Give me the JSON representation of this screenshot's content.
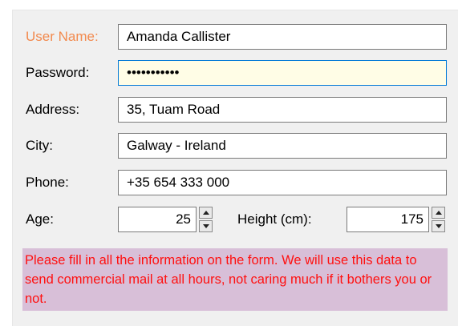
{
  "form": {
    "username": {
      "label": "User Name:",
      "value": "Amanda Callister"
    },
    "password": {
      "label": "Password:",
      "value": "•••••••••••"
    },
    "address": {
      "label": "Address:",
      "value": "35, Tuam Road"
    },
    "city": {
      "label": "City:",
      "value": "Galway - Ireland"
    },
    "phone": {
      "label": "Phone:",
      "value": "+35 654 333 000"
    },
    "age": {
      "label": "Age:",
      "value": "25"
    },
    "height": {
      "label": "Height (cm):",
      "value": "175"
    }
  },
  "notice": "Please fill in all the information on the form. We will use this data to send commercial mail at all hours, not caring much if it bothers you or not.",
  "colors": {
    "accent_label": "#f28a4e",
    "focused_field_bg": "#fffde6",
    "notice_bg": "#d8bfd8",
    "notice_text": "#ff1010"
  }
}
